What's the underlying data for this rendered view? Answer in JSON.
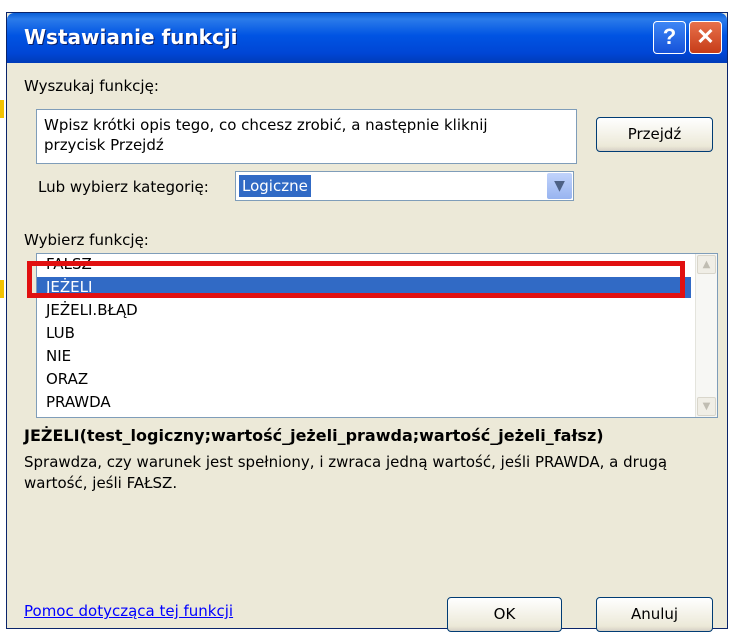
{
  "window": {
    "title": "Wstawianie funkcji",
    "help_icon": "?",
    "close_icon": "✕"
  },
  "search": {
    "label": "Wyszukaj funkcję:",
    "value_line1": "Wpisz krótki opis tego, co chcesz zrobić, a następnie kliknij",
    "value_line2": "przycisk Przejdź",
    "go_button": "Przejdź"
  },
  "category": {
    "label": "Lub wybierz kategorię:",
    "selected": "Logiczne",
    "arrow_icon": "chevron-down-icon"
  },
  "functions": {
    "label": "Wybierz funkcję:",
    "items": [
      "FAŁSZ",
      "JEŻELI",
      "JEŻELI.BŁĄD",
      "LUB",
      "NIE",
      "ORAZ",
      "PRAWDA"
    ],
    "selected_index": 1
  },
  "details": {
    "syntax": "JEŻELI(test_logiczny;wartość_jeżeli_prawda;wartość_jeżeli_fałsz)",
    "description": "Sprawdza, czy warunek jest spełniony, i zwraca jedną wartość, jeśli PRAWDA, a drugą wartość, jeśli FAŁSZ."
  },
  "footer": {
    "help_link": "Pomoc dotycząca tej funkcji",
    "ok_button": "OK",
    "cancel_button": "Anuluj"
  },
  "colors": {
    "titlebar": "#0054e3",
    "selection": "#316ac5",
    "annotation": "#e11010",
    "dialog_bg": "#ece9d8"
  }
}
